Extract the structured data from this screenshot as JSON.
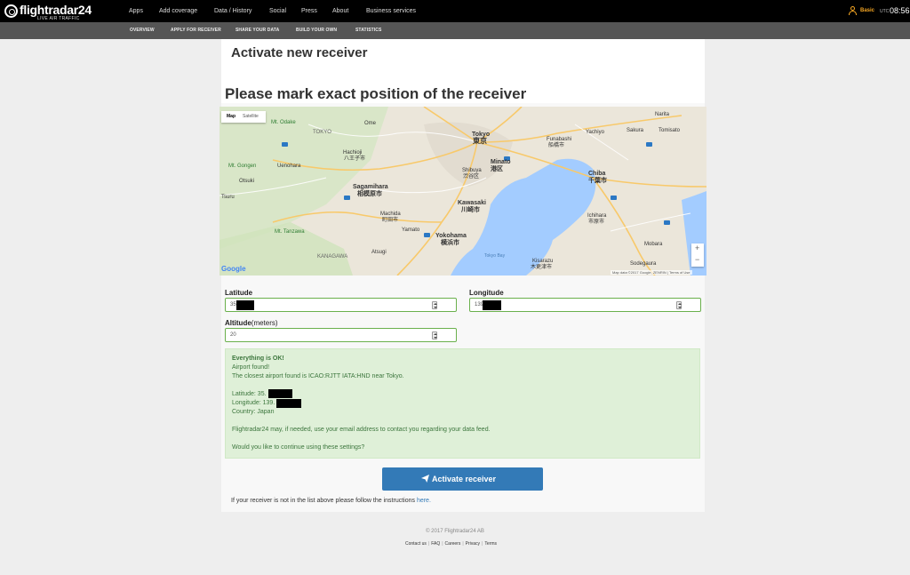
{
  "topnav": {
    "logo": "flightradar24",
    "logo_sub": "LIVE AIR TRAFFIC",
    "items": [
      "Apps",
      "Add coverage",
      "Data / History",
      "Social",
      "Press",
      "About",
      "Business services"
    ],
    "user_plan": "Basic",
    "utc_label": "UTC",
    "time": "08:56"
  },
  "subnav": {
    "items": [
      "OVERVIEW",
      "APPLY FOR RECEIVER",
      "SHARE YOUR DATA",
      "BUILD YOUR OWN",
      "STATISTICS"
    ]
  },
  "page": {
    "title": "Activate new receiver",
    "map_heading": "Please mark exact position of the receiver"
  },
  "map": {
    "type_map": "Map",
    "type_satellite": "Satellite",
    "zoom_in": "+",
    "zoom_out": "−",
    "attribution": "Map data ©2017 Google, ZENRIN | Terms of Use",
    "google": "Google",
    "labels": {
      "tokyo_jp": "東京",
      "tokyo": "Tokyo",
      "tokyo_upper": "TOKYO",
      "minato": "Minato",
      "minato_jp": "港区",
      "shibuya": "Shibuya",
      "shibuya_jp": "渋谷区",
      "kawasaki": "Kawasaki",
      "kawasaki_jp": "川崎市",
      "yokohama": "Yokohama",
      "yokohama_jp": "横浜市",
      "sagamihara": "Sagamihara",
      "sagamihara_jp": "相模原市",
      "hachioji": "Hachioji",
      "hachioji_jp": "八王子市",
      "chiba": "Chiba",
      "chiba_jp": "千葉市",
      "funabashi": "Funabashi",
      "funabashi_jp": "船橋市",
      "kanagawa": "KANAGAWA",
      "machida": "Machida",
      "machida_jp": "町田市",
      "ichihara": "Ichihara",
      "ichihara_jp": "市原市",
      "kisarazu": "Kisarazu",
      "kisarazu_jp": "木更津市",
      "tokyo_bay": "Tokyo Bay",
      "mt_odake": "Mt. Odake",
      "mt_gongen": "Mt. Gongen",
      "mt_tanzawa": "Mt. Tanzawa",
      "yachiyo": "Yachiyo",
      "sakura": "Sakura",
      "narita": "Narita",
      "tomisato": "Tomisato",
      "mobara": "Mobara",
      "sodegaura": "Sodegaura",
      "yamato": "Yamato",
      "atsugi": "Atsugi",
      "otsuki": "Otsuki",
      "uenohara": "Uenohara",
      "tsuru": "Tsuru",
      "ome": "Ome"
    }
  },
  "form": {
    "latitude_label": "Latitude",
    "latitude_value": "35",
    "longitude_label": "Longitude",
    "longitude_value": "139",
    "altitude_label": "Altitude",
    "altitude_unit": "(meters)",
    "altitude_value": "20"
  },
  "alert": {
    "title": "Everything is OK!",
    "line1": "Airport found!",
    "line2": "The closest airport found is ICAO:RJTT IATA:HND near Tokyo.",
    "latitude": "Latitude: 35.",
    "longitude": "Longitude: 139.",
    "country": "Country: Japan",
    "email_note": "Flightradar24 may, if needed, use your email address to contact you regarding your data feed.",
    "question": "Would you like to continue using these settings?"
  },
  "actions": {
    "activate_label": "Activate receiver",
    "instructions_text": "If your receiver is not in the list above please follow the instructions ",
    "instructions_link": "here."
  },
  "footer": {
    "copyright": "© 2017 Flightradar24 AB",
    "links": [
      "Contact us",
      "FAQ",
      "Careers",
      "Privacy",
      "Terms"
    ]
  },
  "colors": {
    "accent": "#f5a623",
    "primary_button": "#337ab7",
    "success_bg": "#dff0d8",
    "success_text": "#3c763d",
    "field_border": "#6ab04c",
    "water": "#a3ccff"
  }
}
